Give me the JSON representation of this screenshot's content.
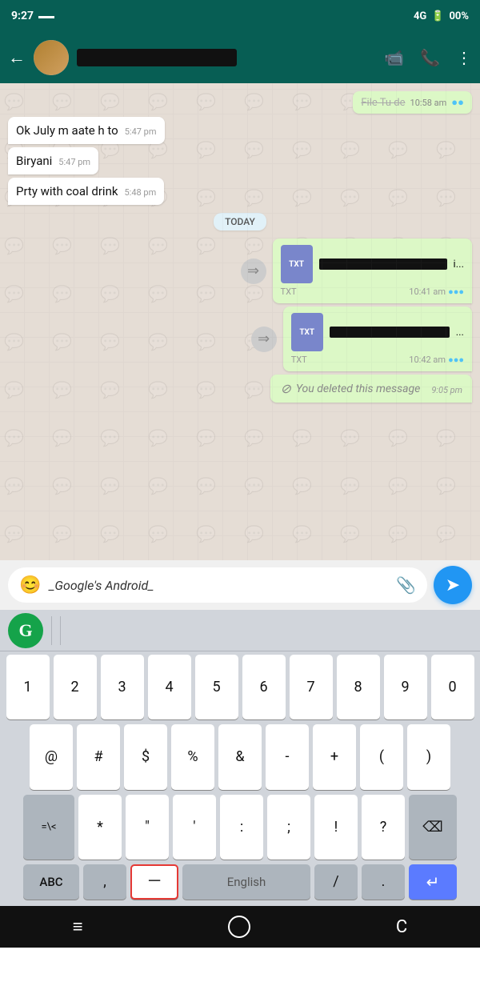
{
  "statusBar": {
    "time": "9:27",
    "signal": "4G",
    "battery": "00%"
  },
  "header": {
    "contactName": "Redacted",
    "icons": {
      "video": "📹",
      "phone": "📞",
      "more": "⋮"
    }
  },
  "chat": {
    "partialTop": {
      "text": "File Tu de",
      "time": "10:58 am"
    },
    "messages": [
      {
        "id": 1,
        "type": "incoming",
        "text": "Ok July m aate h to",
        "time": "5:47 pm"
      },
      {
        "id": 2,
        "type": "incoming",
        "text": "Biryani",
        "time": "5:47 pm"
      },
      {
        "id": 3,
        "type": "incoming",
        "text": "Prty with coal drink",
        "time": "5:48 pm"
      },
      {
        "id": 4,
        "type": "divider",
        "text": "TODAY"
      },
      {
        "id": 5,
        "type": "file-outgoing",
        "ext": "TXT",
        "time": "10:41 am"
      },
      {
        "id": 6,
        "type": "file-outgoing",
        "ext": "TXT",
        "time": "10:42 am"
      },
      {
        "id": 7,
        "type": "deleted",
        "text": "You deleted this message",
        "time": "9:05 pm"
      }
    ]
  },
  "inputBar": {
    "placeholder": "_Google's Android_",
    "emoji": "😊",
    "attach": "📎",
    "send": "➤"
  },
  "keyboard": {
    "grammarly": "G",
    "rows": {
      "numbers": [
        "1",
        "2",
        "3",
        "4",
        "5",
        "6",
        "7",
        "8",
        "9",
        "0"
      ],
      "symbols1": [
        "@",
        "#",
        "$",
        "%",
        "&",
        "-",
        "+",
        "(",
        ")"
      ],
      "symbols2": [
        "=\\<",
        "*",
        "\"",
        "'",
        ":",
        ";",
        " !",
        "?"
      ],
      "bottom": {
        "abc": "ABC",
        "comma": ",",
        "dash": "—",
        "lang": "English",
        "slash": "/",
        "period": ".",
        "enter": "↵"
      }
    }
  },
  "navBar": {
    "menu": "≡",
    "home": "○",
    "back": "C"
  }
}
